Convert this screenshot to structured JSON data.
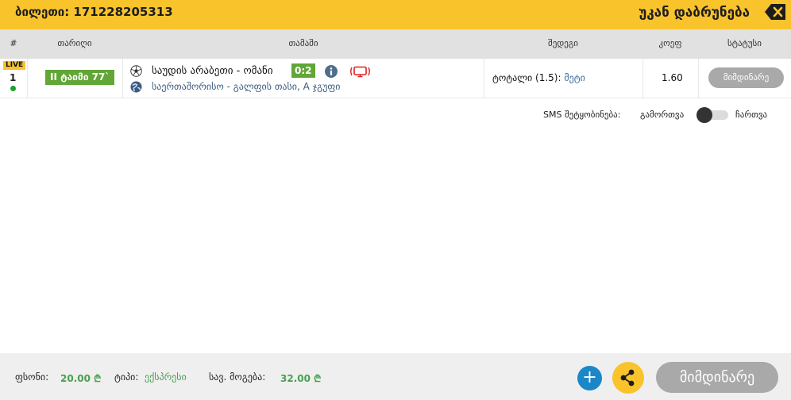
{
  "header": {
    "ticket_label": "ბილეთი: 171228205313",
    "back_label": "უკან დაბრუნება",
    "back_icon": "backspace-close-icon"
  },
  "table": {
    "columns": [
      "#",
      "თარიღი",
      "თამაში",
      "შედეგი",
      "კოეფ",
      "სტატუსი"
    ],
    "rows": [
      {
        "live_badge": "LIVE",
        "index": "1",
        "time": "II ტაიმი 77`",
        "sport_icon": "soccer-ball-icon",
        "match": "საუდის არაბეთი - ომანი",
        "score": "0:2",
        "info_icon": "info-icon",
        "tv_icon": "live-tv-icon",
        "league_icon": "globe-icon",
        "league": "საერთაშორისო - გალფის თასი, A ჯგუფი",
        "market_label": "ტოტალი (1.5):",
        "market_value": "მეტი",
        "odd": "1.60",
        "status": "მიმდინარე"
      }
    ]
  },
  "sms": {
    "label": "SMS შეტყობინება:",
    "off_label": "გამორთვა",
    "on_label": "ჩართვა",
    "enabled": false
  },
  "footer": {
    "stake_label": "ფსონი:",
    "stake_value": "20.00 ₾",
    "type_label": "ტიპი:",
    "type_value": "ექსპრესი",
    "win_label": "სავ. მოგება:",
    "win_value": "32.00 ₾",
    "plus_label": "+",
    "share_icon": "share-icon",
    "status_button": "მიმდინარე"
  },
  "colors": {
    "accent_yellow": "#f9c32c",
    "green": "#61a636",
    "blue": "#1b87c9",
    "gray_button": "#a9a9a9"
  }
}
